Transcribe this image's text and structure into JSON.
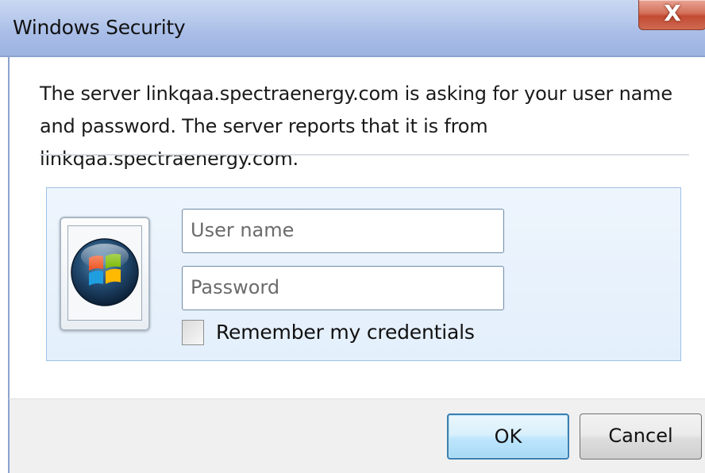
{
  "window": {
    "title": "Windows Security",
    "close_label": "X"
  },
  "message": {
    "text": "The server linkqaa.spectraenergy.com is asking for your user name and password. The server reports that it is from linkqaa.spectraenergy.com."
  },
  "credentials": {
    "username": {
      "value": "",
      "placeholder": "User name"
    },
    "password": {
      "value": "",
      "placeholder": "Password"
    },
    "remember": {
      "label": "Remember my credentials",
      "checked": false
    },
    "avatar_icon": "windows-logo-icon"
  },
  "buttons": {
    "ok_label": "OK",
    "cancel_label": "Cancel"
  },
  "colors": {
    "titlebar": "#b7c9ec",
    "close_button": "#c24a32",
    "panel": "#e3effb",
    "ok_button_border": "#3c7fb1"
  }
}
